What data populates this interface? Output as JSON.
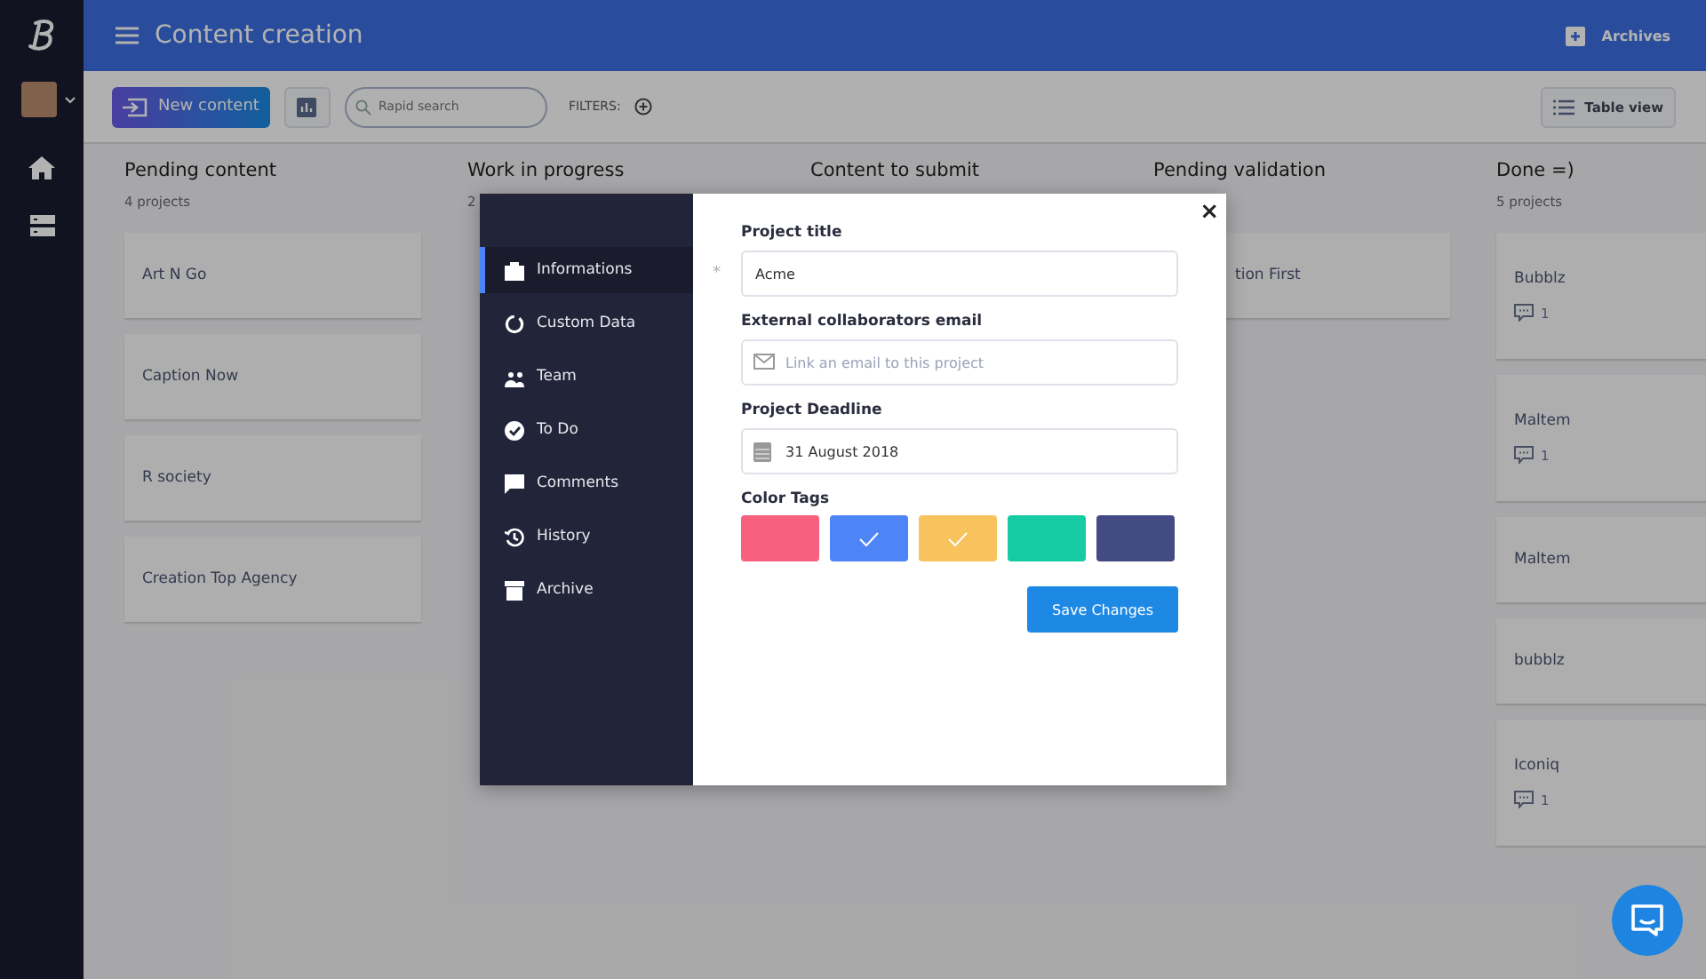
{
  "app": {
    "title": "Content creation",
    "archives": "Archives"
  },
  "toolbar": {
    "new_button": "New content",
    "search": {
      "placeholder": "Rapid search"
    },
    "filters": "FILTERS:",
    "view_button": "Table view"
  },
  "columns": [
    {
      "title": "Pending content",
      "count": "4 projects",
      "cards": [
        {
          "name": "Art N Go"
        },
        {
          "name": "Caption Now"
        },
        {
          "name": "R society"
        },
        {
          "name": "Creation Top Agency"
        }
      ]
    },
    {
      "title": "Work in progress",
      "count": "2"
    },
    {
      "title": "Content to submit"
    },
    {
      "title": "Pending validation",
      "cards": [
        {
          "name": "tion First"
        }
      ]
    },
    {
      "title": "Done =)",
      "count": "5 projects",
      "cards": [
        {
          "name": "Bubblz",
          "comments": "1"
        },
        {
          "name": "Maltem",
          "comments": "1"
        },
        {
          "name": "Maltem"
        },
        {
          "name": "bubblz"
        },
        {
          "name": "Iconiq",
          "comments": "1"
        }
      ]
    }
  ],
  "modal": {
    "nav": [
      {
        "label": "Informations",
        "selected": true
      },
      {
        "label": "Custom Data",
        "selected": false
      },
      {
        "label": "Team",
        "selected": false
      },
      {
        "label": "To Do",
        "selected": false
      },
      {
        "label": "Comments",
        "selected": false
      },
      {
        "label": "History",
        "selected": false
      },
      {
        "label": "Archive",
        "selected": false
      }
    ],
    "close": "×",
    "fields": [
      {
        "label": "Project title",
        "marker": "*",
        "value": "Acme",
        "kind": "text"
      },
      {
        "label": "External collaborators email",
        "placeholder": "Link an email to this project",
        "kind": "email"
      },
      {
        "label": "Project Deadline",
        "value": "31 August 2018",
        "kind": "date"
      }
    ],
    "tags_label": "Color Tags",
    "tags": [
      {
        "color": "#f7607f",
        "checked": false
      },
      {
        "color": "#4d84f6",
        "checked": true
      },
      {
        "color": "#f8c25c",
        "checked": true
      },
      {
        "color": "#14cba3",
        "checked": false
      },
      {
        "color": "#434b84",
        "checked": false
      }
    ],
    "save_button": "Save Changes"
  }
}
